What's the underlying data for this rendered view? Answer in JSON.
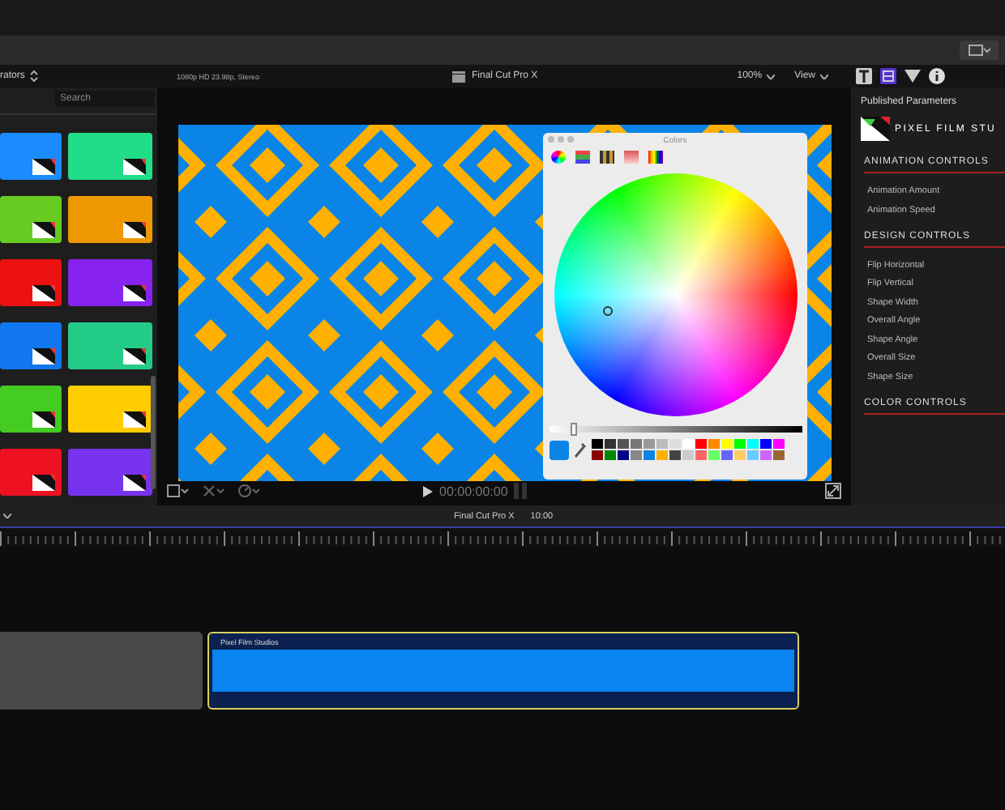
{
  "browser": {
    "title": "rators",
    "search": {
      "placeholder": "Search"
    },
    "thumbnails": [
      {
        "color": "#1a8cff"
      },
      {
        "color": "#22dd88"
      },
      {
        "color": "#66cc22"
      },
      {
        "color": "#ee9900"
      },
      {
        "color": "#ee1111"
      },
      {
        "color": "#8822ee"
      },
      {
        "color": "#1177ee"
      },
      {
        "color": "#22cc88"
      },
      {
        "color": "#44cc22"
      },
      {
        "color": "#ffcc00"
      },
      {
        "color": "#ee1122"
      },
      {
        "color": "#7733ee"
      }
    ]
  },
  "viewer": {
    "format": "1080p HD 23.98p, Stereo",
    "project": "Final Cut Pro X",
    "zoom": "100%",
    "view": "View",
    "timecode": "00:00:00:00",
    "colors_window": {
      "title": "Colors",
      "brightness": {
        "level": 0.1
      }
    }
  },
  "inspector": {
    "title": "Published Parameters",
    "logo_text": "PIXEL FILM STU",
    "sections": [
      {
        "title": "ANIMATION CONTROLS",
        "params": [
          "Animation Amount",
          "Animation Speed"
        ]
      },
      {
        "title": "DESIGN CONTROLS",
        "params": [
          "Flip Horizontal",
          "Flip Vertical",
          "Shape Width",
          "Overall Angle",
          "Shape Angle",
          "Overall Size",
          "Shape Size"
        ]
      },
      {
        "title": "COLOR CONTROLS"
      }
    ]
  },
  "timeline": {
    "project": "Final Cut Pro X",
    "duration": "10:00",
    "clips": [
      {
        "kind": "gap"
      },
      {
        "kind": "generator",
        "title": "Pixel Film Studios",
        "selected": true
      }
    ]
  }
}
